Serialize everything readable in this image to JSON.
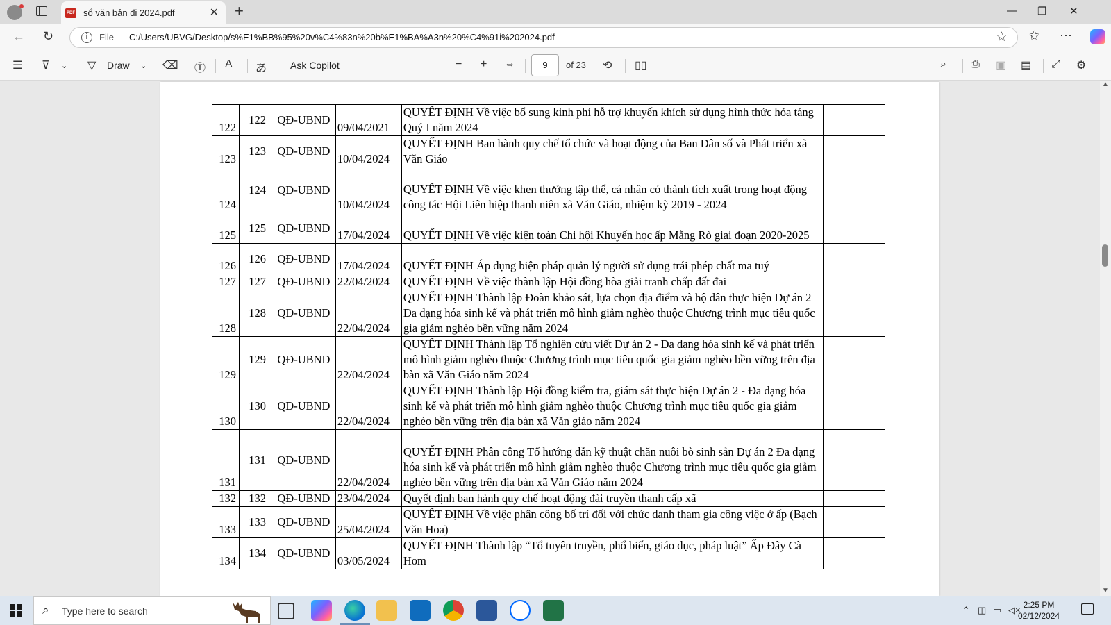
{
  "browser": {
    "tab_title": "sổ văn bản đi 2024.pdf",
    "address_scheme": "File",
    "address_url": "C:/Users/UBVG/Desktop/s%E1%BB%95%20v%C4%83n%20b%E1%BA%A3n%20%C4%91i%202024.pdf"
  },
  "pdf_toolbar": {
    "draw_label": "Draw",
    "ask_copilot_label": "Ask Copilot",
    "current_page": "9",
    "page_count": "of 23"
  },
  "document": {
    "rows": [
      {
        "num": "122",
        "num2": "122",
        "type": "QĐ-UBND",
        "date": "09/04/2021",
        "content": "QUYẾT ĐỊNH Về việc bổ sung kinh phí hỗ trợ khuyến khích sử dụng hình thức hỏa táng Quý I năm 2024"
      },
      {
        "num": "123",
        "num2": "123",
        "type": "QĐ-UBND",
        "date": "10/04/2024",
        "content": "QUYẾT ĐỊNH Ban hành quy chế tổ chức và hoạt động của Ban Dân số và Phát triển xã Văn Giáo"
      },
      {
        "num": "124",
        "num2": "124",
        "type": "QĐ-UBND",
        "date": "10/04/2024",
        "content": "QUYẾT ĐỊNH Về việc khen thưởng tập thể, cá nhân có thành tích xuất trong hoạt động công tác Hội Liên hiệp thanh niên xã Văn Giáo, nhiệm kỳ 2019 - 2024"
      },
      {
        "num": "125",
        "num2": "125",
        "type": "QĐ-UBND",
        "date": "17/04/2024",
        "content": "QUYẾT ĐỊNH Về việc kiện toàn Chi hội Khuyến học ấp Mằng Rò giai đoạn 2020-2025"
      },
      {
        "num": "126",
        "num2": "126",
        "type": "QĐ-UBND",
        "date": "17/04/2024",
        "content": "QUYẾT ĐỊNH Áp dụng biện pháp quản lý người sử dụng trái phép chất ma tuý"
      },
      {
        "num": "127",
        "num2": "127",
        "type": "QĐ-UBND",
        "date": "22/04/2024",
        "content": "QUYẾT ĐỊNH Về việc thành lập Hội đồng hòa giải tranh chấp đất đai"
      },
      {
        "num": "128",
        "num2": "128",
        "type": "QĐ-UBND",
        "date": "22/04/2024",
        "content": "QUYẾT ĐỊNH Thành lập Đoàn khảo sát, lựa chọn địa điểm và hộ dân thực hiện Dự án 2 Đa dạng hóa sinh kế và phát triển mô hình giảm nghèo thuộc Chương trình mục tiêu quốc gia giảm nghèo bền vững năm 2024"
      },
      {
        "num": "129",
        "num2": "129",
        "type": "QĐ-UBND",
        "date": "22/04/2024",
        "content": "QUYẾT ĐỊNH Thành lập Tổ nghiên cứu viết Dự án 2 - Đa dạng hóa sinh kế và phát triển mô hình giảm nghèo thuộc Chương trình mục tiêu quốc gia giảm nghèo bền vững trên địa bàn xã Văn Giáo năm 2024"
      },
      {
        "num": "130",
        "num2": "130",
        "type": "QĐ-UBND",
        "date": "22/04/2024",
        "content": "QUYẾT ĐỊNH Thành lập Hội đồng kiểm tra, giám sát thực hiện Dự án 2 - Đa dạng hóa sinh kế và phát triển mô hình giảm nghèo thuộc Chương trình mục tiêu quốc gia giảm nghèo bền vững trên địa bàn xã Văn giáo năm 2024"
      },
      {
        "num": "131",
        "num2": "131",
        "type": "QĐ-UBND",
        "date": "22/04/2024",
        "content": "QUYẾT ĐỊNH Phân công Tổ hướng dẫn kỹ thuật chăn nuôi bò sinh sản Dự án 2 Đa dạng hóa sinh kế và phát triển mô hình giảm nghèo thuộc Chương trình mục tiêu quốc gia giảm nghèo bền vững trên địa bàn xã Văn Giáo năm 2024"
      },
      {
        "num": "132",
        "num2": "132",
        "type": "QĐ-UBND",
        "date": "23/04/2024",
        "content": "Quyết định ban hành quy chế hoạt động đài truyền thanh cấp xã"
      },
      {
        "num": "133",
        "num2": "133",
        "type": "QĐ-UBND",
        "date": "25/04/2024",
        "content": "QUYẾT ĐỊNH Về việc phân công bố trí đối với chức danh tham gia công việc ở ấp (Bạch Văn Hoa)"
      },
      {
        "num": "134",
        "num2": "134",
        "type": "QĐ-UBND",
        "date": "03/05/2024",
        "content": "QUYẾT ĐỊNH Thành lập “Tổ tuyên truyền, phổ biến, giáo dục, pháp luật” Ấp Đây Cà Hom"
      }
    ]
  },
  "taskbar": {
    "search_placeholder": "Type here to search",
    "time": "2:25 PM",
    "date": "02/12/2024"
  }
}
